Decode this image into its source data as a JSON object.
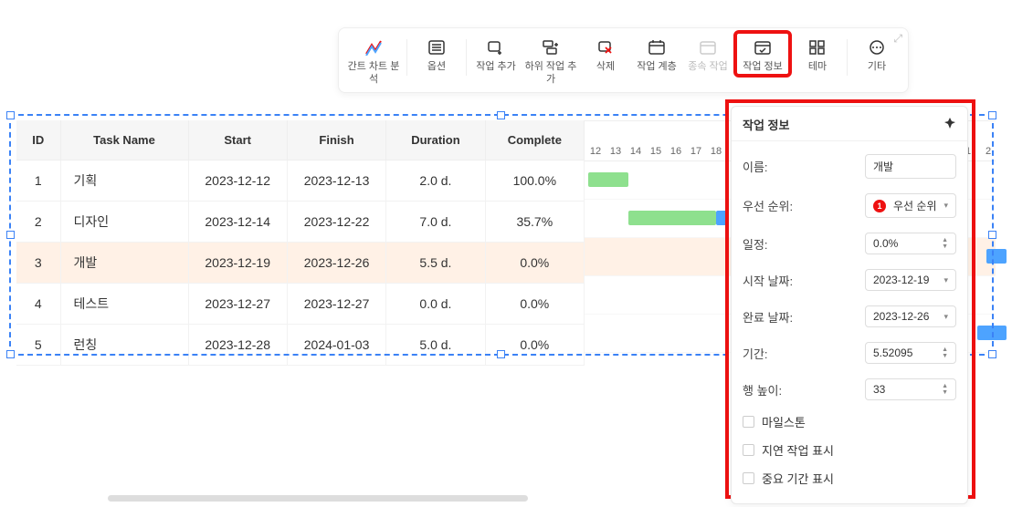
{
  "toolbar": {
    "analysis": "간트 차트 분석",
    "options": "옵션",
    "add_task": "작업 추가",
    "add_subtask": "하위 작업 추가",
    "delete": "삭제",
    "hierarchy": "작업 계층",
    "dependency": "종속 작업",
    "task_info": "작업 정보",
    "theme": "테마",
    "more": "기타"
  },
  "columns": {
    "id": "ID",
    "name": "Task Name",
    "start": "Start",
    "finish": "Finish",
    "duration": "Duration",
    "complete": "Complete"
  },
  "rows": [
    {
      "id": "1",
      "name": "기획",
      "start": "2023-12-12",
      "finish": "2023-12-13",
      "duration": "2.0 d.",
      "complete": "100.0%"
    },
    {
      "id": "2",
      "name": "디자인",
      "start": "2023-12-14",
      "finish": "2023-12-22",
      "duration": "7.0 d.",
      "complete": "35.7%"
    },
    {
      "id": "3",
      "name": "개발",
      "start": "2023-12-19",
      "finish": "2023-12-26",
      "duration": "5.5 d.",
      "complete": "0.0%"
    },
    {
      "id": "4",
      "name": "테스트",
      "start": "2023-12-27",
      "finish": "2023-12-27",
      "duration": "0.0 d.",
      "complete": "0.0%"
    },
    {
      "id": "5",
      "name": "런칭",
      "start": "2023-12-28",
      "finish": "2024-01-03",
      "duration": "5.0 d.",
      "complete": "0.0%"
    }
  ],
  "gantt_days": [
    "12",
    "13",
    "14",
    "15",
    "16",
    "17",
    "18",
    "1",
    "2"
  ],
  "panel": {
    "title": "작업 정보",
    "labels": {
      "name": "이름:",
      "priority": "우선 순위:",
      "progress": "일정:",
      "start_date": "시작 날짜:",
      "end_date": "완료 날짜:",
      "duration": "기간:",
      "row_height": "행 높이:"
    },
    "values": {
      "name": "개발",
      "priority_badge": "1",
      "priority_text": "우선 순위",
      "progress": "0.0%",
      "start_date": "2023-12-19",
      "end_date": "2023-12-26",
      "duration": "5.52095",
      "row_height": "33"
    },
    "checks": {
      "milestone": "마일스톤",
      "show_delayed": "지연 작업 표시",
      "show_critical": "중요 기간 표시"
    }
  }
}
